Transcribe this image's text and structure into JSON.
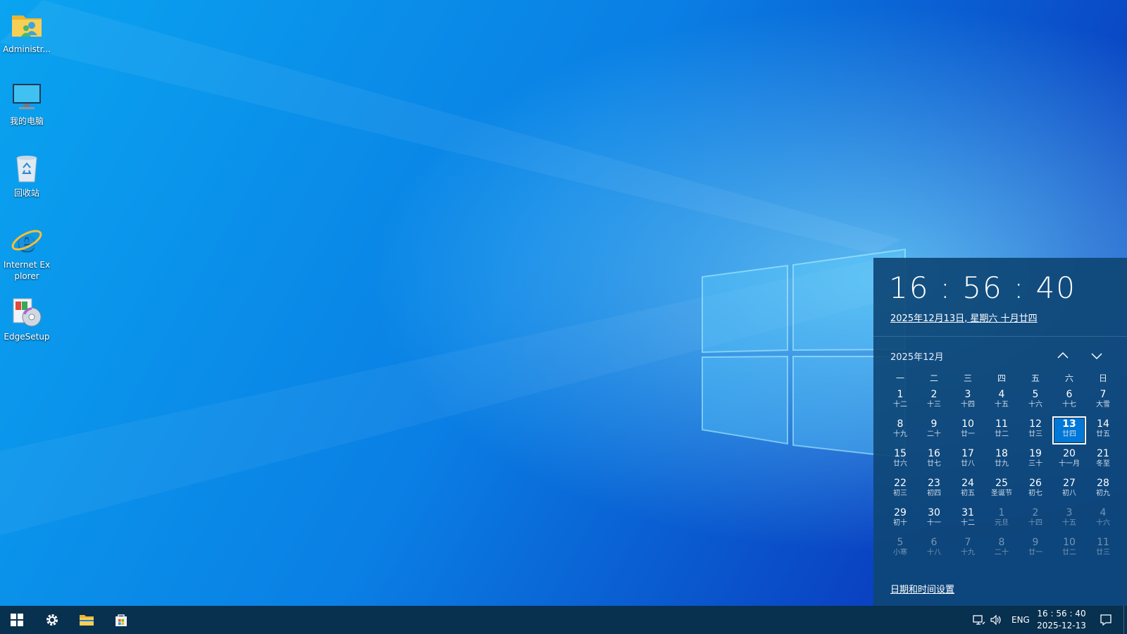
{
  "desktop": {
    "icons": [
      {
        "name": "user-folder-icon",
        "label": "Administr..."
      },
      {
        "name": "computer-icon",
        "label": "我的电脑"
      },
      {
        "name": "recycle-bin-icon",
        "label": "回收站"
      },
      {
        "name": "internet-explorer-icon",
        "label": "Internet Explorer"
      },
      {
        "name": "edge-setup-icon",
        "label": "EdgeSetup"
      }
    ]
  },
  "flyout": {
    "time": "16 : 56 : 40",
    "date_long": "2025年12月13日, 星期六 十月廿四",
    "month": "2025年12月",
    "weekdays": [
      "一",
      "二",
      "三",
      "四",
      "五",
      "六",
      "日"
    ],
    "weeks": [
      [
        {
          "n": "1",
          "l": "十二"
        },
        {
          "n": "2",
          "l": "十三"
        },
        {
          "n": "3",
          "l": "十四"
        },
        {
          "n": "4",
          "l": "十五"
        },
        {
          "n": "5",
          "l": "十六"
        },
        {
          "n": "6",
          "l": "十七"
        },
        {
          "n": "7",
          "l": "大雪"
        }
      ],
      [
        {
          "n": "8",
          "l": "十九"
        },
        {
          "n": "9",
          "l": "二十"
        },
        {
          "n": "10",
          "l": "廿一"
        },
        {
          "n": "11",
          "l": "廿二"
        },
        {
          "n": "12",
          "l": "廿三"
        },
        {
          "n": "13",
          "l": "廿四",
          "today": true
        },
        {
          "n": "14",
          "l": "廿五"
        }
      ],
      [
        {
          "n": "15",
          "l": "廿六"
        },
        {
          "n": "16",
          "l": "廿七"
        },
        {
          "n": "17",
          "l": "廿八"
        },
        {
          "n": "18",
          "l": "廿九"
        },
        {
          "n": "19",
          "l": "三十"
        },
        {
          "n": "20",
          "l": "十一月"
        },
        {
          "n": "21",
          "l": "冬至"
        }
      ],
      [
        {
          "n": "22",
          "l": "初三"
        },
        {
          "n": "23",
          "l": "初四"
        },
        {
          "n": "24",
          "l": "初五"
        },
        {
          "n": "25",
          "l": "圣诞节"
        },
        {
          "n": "26",
          "l": "初七"
        },
        {
          "n": "27",
          "l": "初八"
        },
        {
          "n": "28",
          "l": "初九"
        }
      ],
      [
        {
          "n": "29",
          "l": "初十"
        },
        {
          "n": "30",
          "l": "十一"
        },
        {
          "n": "31",
          "l": "十二"
        },
        {
          "n": "1",
          "l": "元旦",
          "other": true
        },
        {
          "n": "2",
          "l": "十四",
          "other": true
        },
        {
          "n": "3",
          "l": "十五",
          "other": true
        },
        {
          "n": "4",
          "l": "十六",
          "other": true
        }
      ],
      [
        {
          "n": "5",
          "l": "小寒",
          "other": true
        },
        {
          "n": "6",
          "l": "十八",
          "other": true
        },
        {
          "n": "7",
          "l": "十九",
          "other": true
        },
        {
          "n": "8",
          "l": "二十",
          "other": true
        },
        {
          "n": "9",
          "l": "廿一",
          "other": true
        },
        {
          "n": "10",
          "l": "廿二",
          "other": true
        },
        {
          "n": "11",
          "l": "廿三",
          "other": true
        }
      ]
    ],
    "settings_link": "日期和时间设置"
  },
  "taskbar": {
    "lang": "ENG",
    "time": "16 : 56 : 40",
    "date": "2025-12-13"
  },
  "colors": {
    "flyout_bg": "#0e4676",
    "taskbar_bg": "#08304f",
    "today": "#0078d7"
  }
}
